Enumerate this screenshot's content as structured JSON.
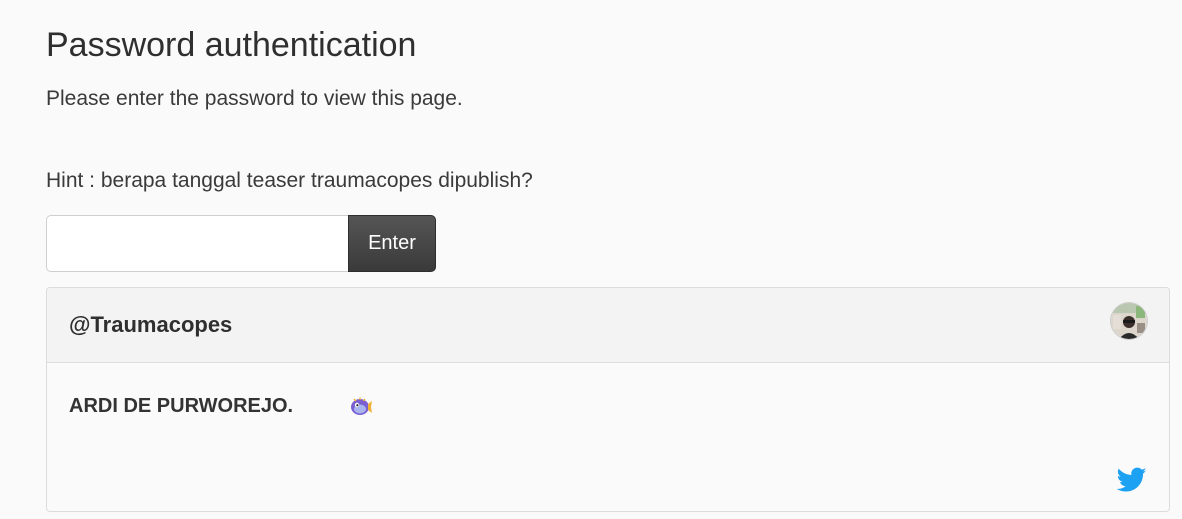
{
  "page": {
    "title": "Password authentication",
    "description": "Please enter the password to view this page.",
    "hint": "Hint : berapa tanggal teaser traumacopes dipublish?"
  },
  "form": {
    "password_value": "",
    "submit_label": "Enter"
  },
  "tweet_card": {
    "handle": "@Traumacopes",
    "text": "ARDI DE PURWOREJO.",
    "avatar_icon": "user-avatar",
    "emoji_icon": "pufferfish-emoji",
    "brand_icon": "twitter-bird-icon",
    "brand_color": "#1da1f2"
  }
}
